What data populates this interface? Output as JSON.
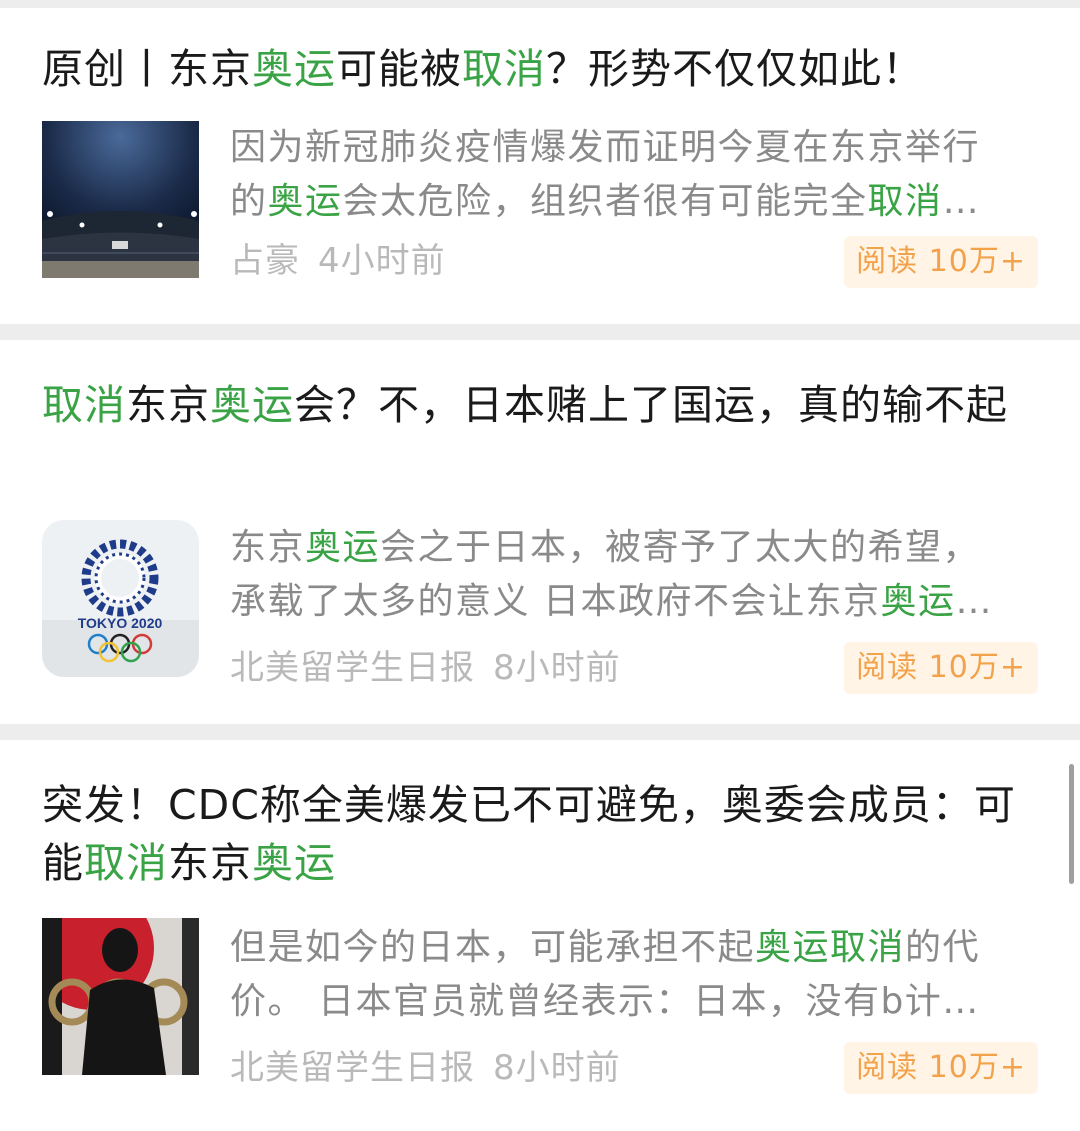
{
  "articles": [
    {
      "title_parts": [
        {
          "text": "原创丨东京",
          "hl": false
        },
        {
          "text": "奥运",
          "hl": true
        },
        {
          "text": "可能被",
          "hl": false
        },
        {
          "text": "取消",
          "hl": true
        },
        {
          "text": "？形势不仅仅如此！",
          "hl": false
        }
      ],
      "summary_lines": [
        [
          {
            "text": "因为新冠肺炎疫情爆发而证明今夏在东京举行",
            "hl": false
          }
        ],
        [
          {
            "text": "的",
            "hl": false
          },
          {
            "text": "奥运",
            "hl": true
          },
          {
            "text": "会太危险，组织者很有可能完全",
            "hl": false
          },
          {
            "text": "取消",
            "hl": true
          },
          {
            "text": "…",
            "hl": false
          }
        ]
      ],
      "source": "占豪",
      "time": "4小时前",
      "reads": "阅读 10万+",
      "thumbnail": "stadium-night-image"
    },
    {
      "title_parts": [
        {
          "text": "取消",
          "hl": true
        },
        {
          "text": "东京",
          "hl": false
        },
        {
          "text": "奥运",
          "hl": true
        },
        {
          "text": "会？不，日本赌上了国运，真的输不起",
          "hl": false
        }
      ],
      "summary_lines": [
        [
          {
            "text": "东京",
            "hl": false
          },
          {
            "text": "奥运",
            "hl": true
          },
          {
            "text": "会之于日本，被寄予了太大的希望，",
            "hl": false
          }
        ],
        [
          {
            "text": "承载了太多的意义 日本政府不会让东京",
            "hl": false
          },
          {
            "text": "奥运",
            "hl": true
          },
          {
            "text": "…",
            "hl": false
          }
        ]
      ],
      "source": "北美留学生日报",
      "time": "8小时前",
      "reads": "阅读 10万+",
      "thumbnail": "tokyo-2020-logo-image",
      "logo_text": "TOKYO 2020"
    },
    {
      "title_parts": [
        {
          "text": "突发！CDC称全美爆发已不可避免，奥委会成员：可能",
          "hl": false
        },
        {
          "text": "取消",
          "hl": true
        },
        {
          "text": "东京",
          "hl": false
        },
        {
          "text": "奥运",
          "hl": true
        }
      ],
      "summary_lines": [
        [
          {
            "text": "但是如今的日本，可能承担不起",
            "hl": false
          },
          {
            "text": "奥运取消",
            "hl": true
          },
          {
            "text": "的代",
            "hl": false
          }
        ],
        [
          {
            "text": "价。 日本官员就曾经表示：日本，没有b计…",
            "hl": false
          }
        ]
      ],
      "source": "北美留学生日报",
      "time": "8小时前",
      "reads": "阅读 10万+",
      "thumbnail": "olympic-rings-silhouette-image"
    }
  ],
  "colors": {
    "highlight": "#3aa345",
    "title": "#1a1a1a",
    "summary": "#8a8a8a",
    "meta": "#b9b9b9",
    "badge_text": "#f2a24a",
    "badge_bg": "#fff4e6",
    "divider": "#ededed"
  }
}
